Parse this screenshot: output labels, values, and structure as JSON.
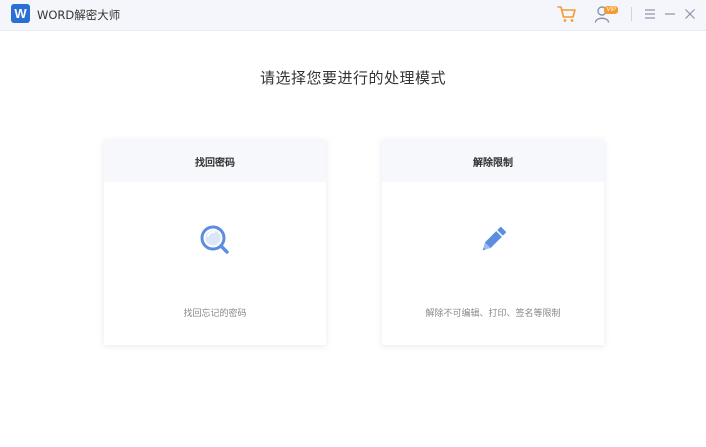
{
  "app": {
    "logo_letter": "W",
    "title": "WORD解密大师"
  },
  "toolbar": {
    "cart_icon": "cart-icon",
    "user_icon": "user-vip-icon",
    "user_badge": "VIP",
    "menu_icon": "menu-icon",
    "minimize_icon": "minimize-icon",
    "close_icon": "close-icon"
  },
  "main": {
    "title": "请选择您要进行的处理模式",
    "cards": [
      {
        "label": "找回密码",
        "icon": "search-icon",
        "description": "找回忘记的密码"
      },
      {
        "label": "解除限制",
        "icon": "pencil-icon",
        "description": "解除不可编辑、打印、签名等限制"
      }
    ]
  },
  "colors": {
    "accent": "#2b6fd6",
    "icon_blue": "#5b8de0",
    "cart_orange": "#f39c32",
    "titlebar_bg": "#f4f6fb",
    "card_header_bg": "#f6f8fc"
  }
}
